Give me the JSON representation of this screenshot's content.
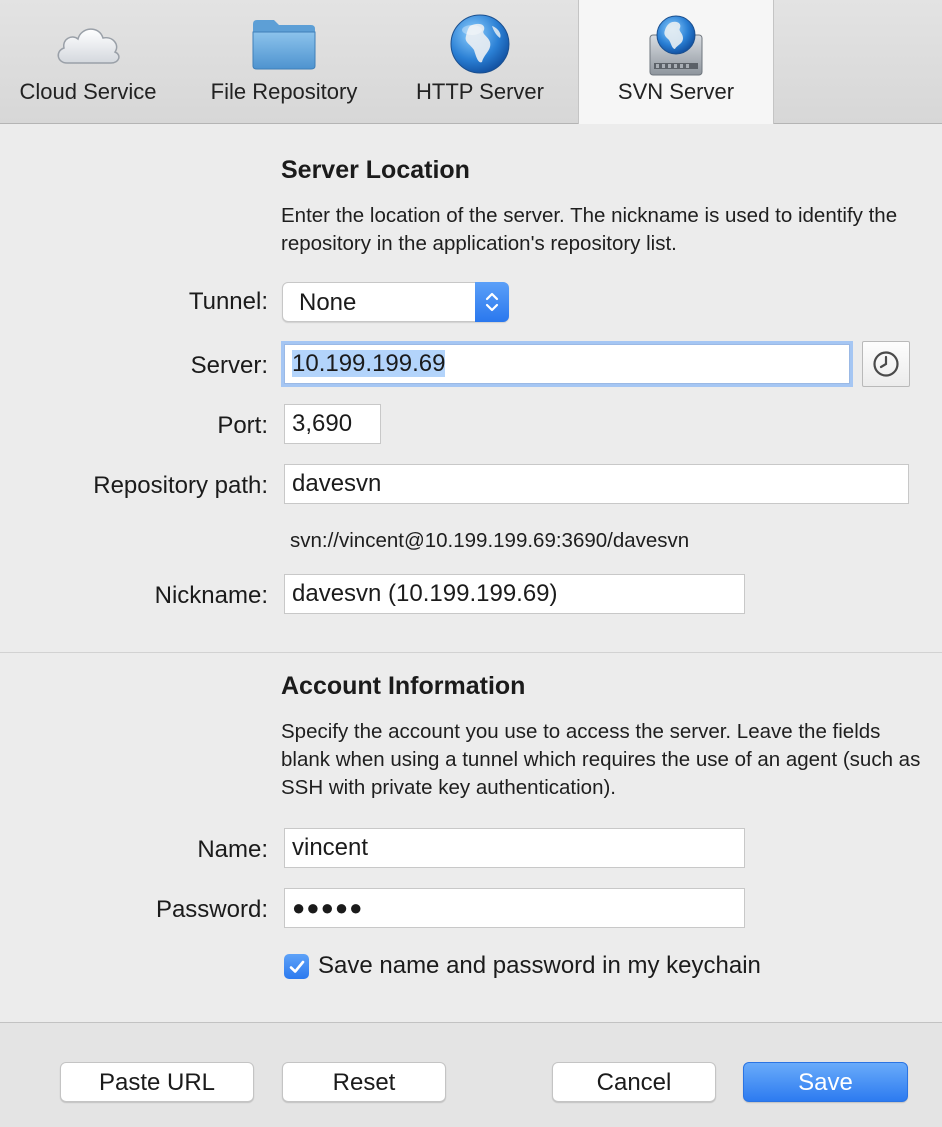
{
  "tabs": [
    {
      "label": "Cloud Service",
      "icon": "cloud-icon",
      "selected": false
    },
    {
      "label": "File Repository",
      "icon": "folder-icon",
      "selected": false
    },
    {
      "label": "HTTP Server",
      "icon": "globe-icon",
      "selected": false
    },
    {
      "label": "SVN Server",
      "icon": "server-globe-icon",
      "selected": true
    }
  ],
  "server_location": {
    "title": "Server Location",
    "description": "Enter the location of the server. The nickname is used to identify the repository in the application's repository list.",
    "tunnel_label": "Tunnel:",
    "tunnel_value": "None",
    "server_label": "Server:",
    "server_value": "10.199.199.69",
    "port_label": "Port:",
    "port_value": "3,690",
    "repo_label": "Repository path:",
    "repo_value": "davesvn",
    "url_preview": "svn://vincent@10.199.199.69:3690/davesvn",
    "nickname_label": "Nickname:",
    "nickname_value": "davesvn (10.199.199.69)"
  },
  "account": {
    "title": "Account Information",
    "description": "Specify the account you use to access the server. Leave the fields blank when using a tunnel which requires the use of an agent (such as SSH with private key authentication).",
    "name_label": "Name:",
    "name_value": "vincent",
    "password_label": "Password:",
    "password_value": "●●●●●",
    "keychain_label": "Save name and password in my keychain",
    "keychain_checked": true
  },
  "buttons": {
    "paste_url": "Paste URL",
    "reset": "Reset",
    "cancel": "Cancel",
    "save": "Save"
  },
  "colors": {
    "accent": "#2d7bf0",
    "selection": "#b3d4fb",
    "background": "#ececec"
  }
}
